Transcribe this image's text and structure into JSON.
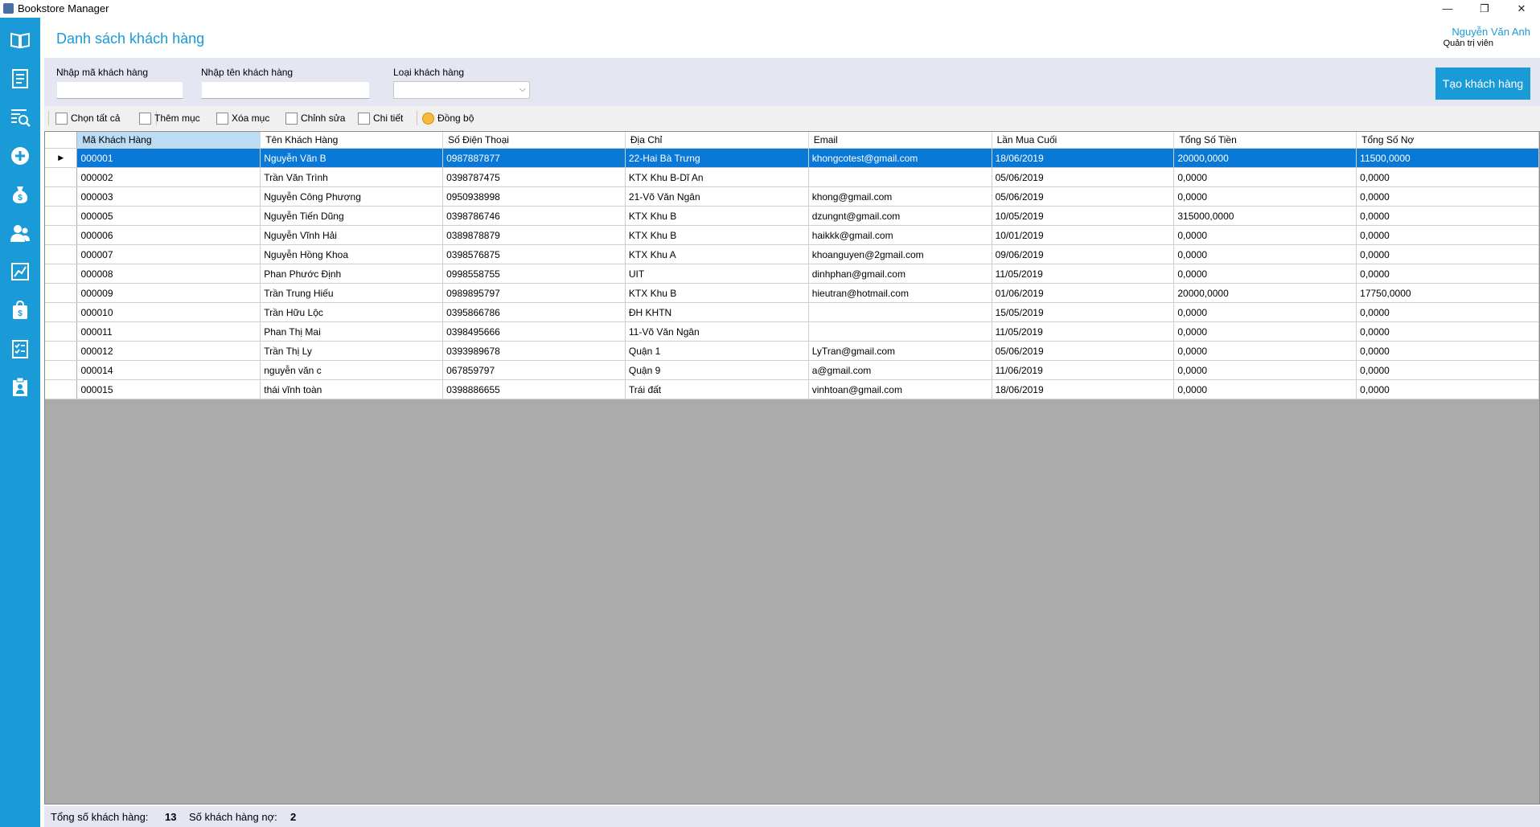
{
  "window": {
    "title": "Bookstore Manager",
    "minimize": "—",
    "restore": "❐",
    "close": "✕"
  },
  "sidebar": {
    "icons": [
      "book-icon",
      "invoice-icon",
      "search-list-icon",
      "add-circle-icon",
      "money-bag-icon",
      "users-icon",
      "chart-icon",
      "shopping-bag-icon",
      "checklist-icon",
      "clipboard-person-icon"
    ]
  },
  "header": {
    "title": "Danh sách khách hàng",
    "user_name": "Nguyễn Văn Anh",
    "user_role": "Quản trị viên"
  },
  "filters": {
    "id_label": "Nhập mã khách hàng",
    "id_value": "",
    "name_label": "Nhập tên khách hàng",
    "name_value": "",
    "type_label": "Loại khách hàng",
    "type_value": "",
    "create_button": "Tạo khách hàng"
  },
  "toolbar": {
    "select_all": "Chọn tất cả",
    "add": "Thêm mục",
    "delete": "Xóa mục",
    "edit": "Chỉnh sửa",
    "detail": "Chi tiết",
    "sync": "Đồng bộ"
  },
  "table": {
    "columns": [
      "Mã Khách Hàng",
      "Tên Khách Hàng",
      "Số Điện Thoại",
      "Địa Chỉ",
      "Email",
      "Lần Mua Cuối",
      "Tổng Số Tiền",
      "Tổng Số Nợ"
    ],
    "selected_marker": "▶",
    "rows": [
      [
        "000001",
        "Nguyễn Văn B",
        "0987887877",
        "22-Hai Bà Trưng",
        "khongcotest@gmail.com",
        "18/06/2019",
        "20000,0000",
        "11500,0000"
      ],
      [
        "000002",
        "Trần Văn Trình",
        "0398787475",
        "KTX Khu B-Dĩ An",
        "",
        "05/06/2019",
        "0,0000",
        "0,0000"
      ],
      [
        "000003",
        "Nguyễn Công Phượng",
        "0950938998",
        "21-Võ Văn Ngân",
        "khong@gmail.com",
        "05/06/2019",
        "0,0000",
        "0,0000"
      ],
      [
        "000005",
        "Nguyễn Tiến Dũng",
        "0398786746",
        "KTX Khu B",
        "dzungnt@gmail.com",
        "10/05/2019",
        "315000,0000",
        "0,0000"
      ],
      [
        "000006",
        "Nguyễn Vĩnh Hải",
        "0389878879",
        "KTX Khu B",
        "haikkk@gmail.com",
        "10/01/2019",
        "0,0000",
        "0,0000"
      ],
      [
        "000007",
        "Nguyễn Hồng Khoa",
        "0398576875",
        "KTX Khu A",
        "khoanguyen@2gmail.com",
        "09/06/2019",
        "0,0000",
        "0,0000"
      ],
      [
        "000008",
        "Phan Phước Định",
        "0998558755",
        "UIT",
        "dinhphan@gmail.com",
        "11/05/2019",
        "0,0000",
        "0,0000"
      ],
      [
        "000009",
        "Trần Trung Hiếu",
        "0989895797",
        "KTX Khu B",
        "hieutran@hotmail.com",
        "01/06/2019",
        "20000,0000",
        "17750,0000"
      ],
      [
        "000010",
        "Trần Hữu Lộc",
        "0395866786",
        "ĐH KHTN",
        "",
        "15/05/2019",
        "0,0000",
        "0,0000"
      ],
      [
        "000011",
        "Phan Thị Mai",
        "0398495666",
        "11-Võ Văn Ngân",
        "",
        "11/05/2019",
        "0,0000",
        "0,0000"
      ],
      [
        "000012",
        "Trần Thị Ly",
        "0393989678",
        "Quận 1",
        "LyTran@gmail.com",
        "05/06/2019",
        "0,0000",
        "0,0000"
      ],
      [
        "000014",
        "nguyễn văn c",
        "067859797",
        "Quận 9",
        "a@gmail.com",
        "11/06/2019",
        "0,0000",
        "0,0000"
      ],
      [
        "000015",
        "thái vĩnh toàn",
        "0398886655",
        "Trái đất",
        "vinhtoan@gmail.com",
        "18/06/2019",
        "0,0000",
        "0,0000"
      ]
    ]
  },
  "status": {
    "total_label": "Tổng số khách hàng:",
    "total_value": "13",
    "debt_label": "Số khách hàng nợ:",
    "debt_value": "2"
  },
  "colors": {
    "accent": "#1a9ad6",
    "selected_row": "#0a78d7",
    "grid_empty": "#ababab"
  }
}
